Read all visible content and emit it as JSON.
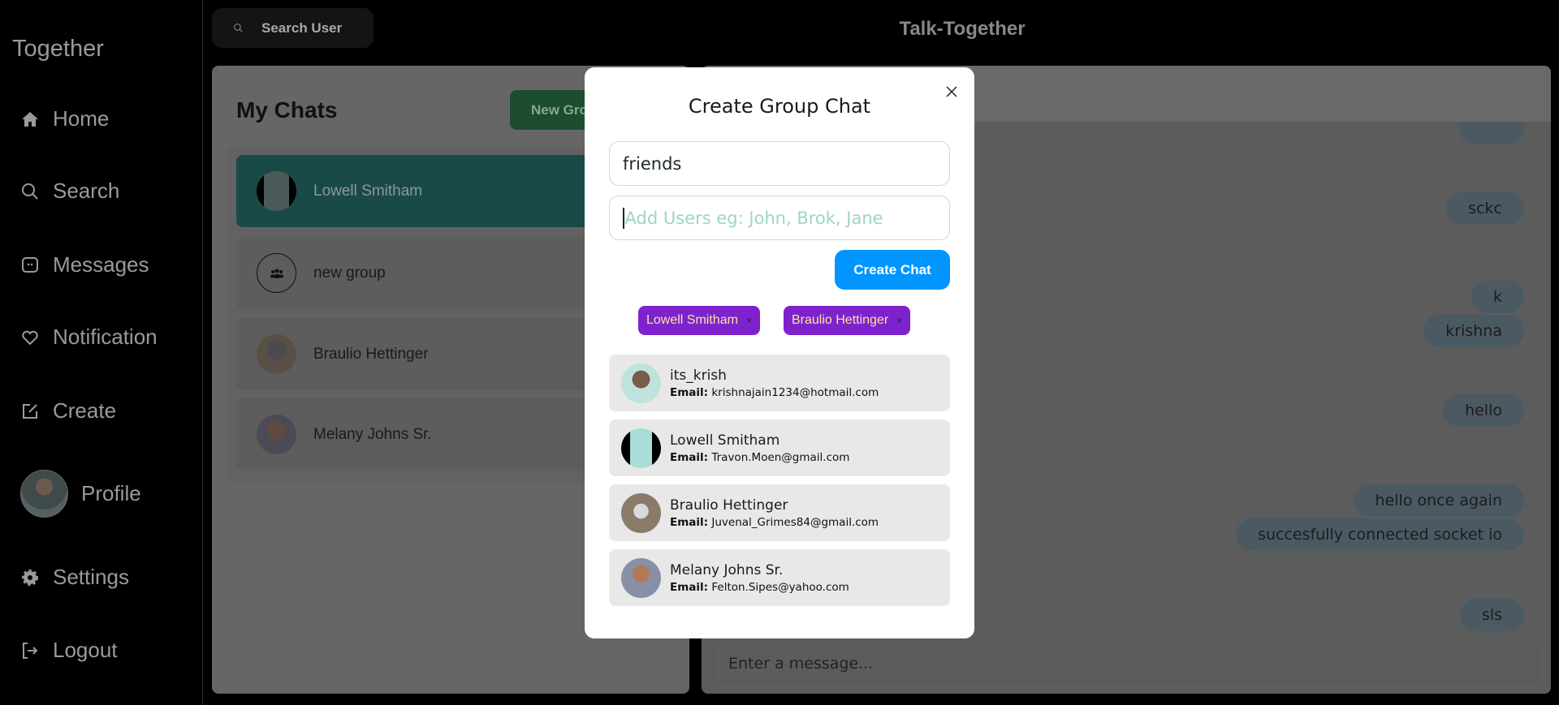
{
  "sidebar": {
    "brand": "Together",
    "items": [
      {
        "label": "Home",
        "icon": "home-icon"
      },
      {
        "label": "Search",
        "icon": "search-icon"
      },
      {
        "label": "Messages",
        "icon": "message-icon"
      },
      {
        "label": "Notification",
        "icon": "heart-icon"
      },
      {
        "label": "Create",
        "icon": "edit-icon"
      },
      {
        "label": "Profile",
        "icon": "avatar"
      },
      {
        "label": "Settings",
        "icon": "gear-icon"
      },
      {
        "label": "Logout",
        "icon": "logout-icon"
      }
    ]
  },
  "header": {
    "search_label": "Search User",
    "title": "Talk-Together"
  },
  "chats": {
    "title": "My Chats",
    "new_group_label": "New Group Chat",
    "items": [
      {
        "name": "Lowell Smitham",
        "selected": true
      },
      {
        "name": "new group",
        "group": true
      },
      {
        "name": "Braulio Hettinger"
      },
      {
        "name": "Melany Johns Sr."
      }
    ]
  },
  "messages": {
    "items": [
      "",
      "sckc",
      "k",
      "krishna",
      "hello",
      "hello once again",
      "succesfully connected socket io",
      "sls"
    ],
    "input_placeholder": "Enter a message..."
  },
  "modal": {
    "title": "Create Group Chat",
    "chat_name_value": "friends",
    "add_users_placeholder": "Add Users eg: John, Brok, Jane",
    "create_label": "Create Chat",
    "selected_users": [
      "Lowell Smitham",
      "Braulio Hettinger"
    ],
    "remove_glyph": "×",
    "email_label": "Email:",
    "results": [
      {
        "name": "its_krish",
        "email": "krishnajain1234@hotmail.com"
      },
      {
        "name": "Lowell Smitham",
        "email": "Travon.Moen@gmail.com"
      },
      {
        "name": "Braulio Hettinger",
        "email": "Juvenal_Grimes84@gmail.com"
      },
      {
        "name": "Melany Johns Sr.",
        "email": "Felton.Sipes@yahoo.com"
      }
    ]
  },
  "colors": {
    "accent_blue": "#0095ff",
    "badge_purple": "#7e22ce",
    "selected_teal": "#38B2AC",
    "bubble_blue": "#BEE3F8"
  }
}
